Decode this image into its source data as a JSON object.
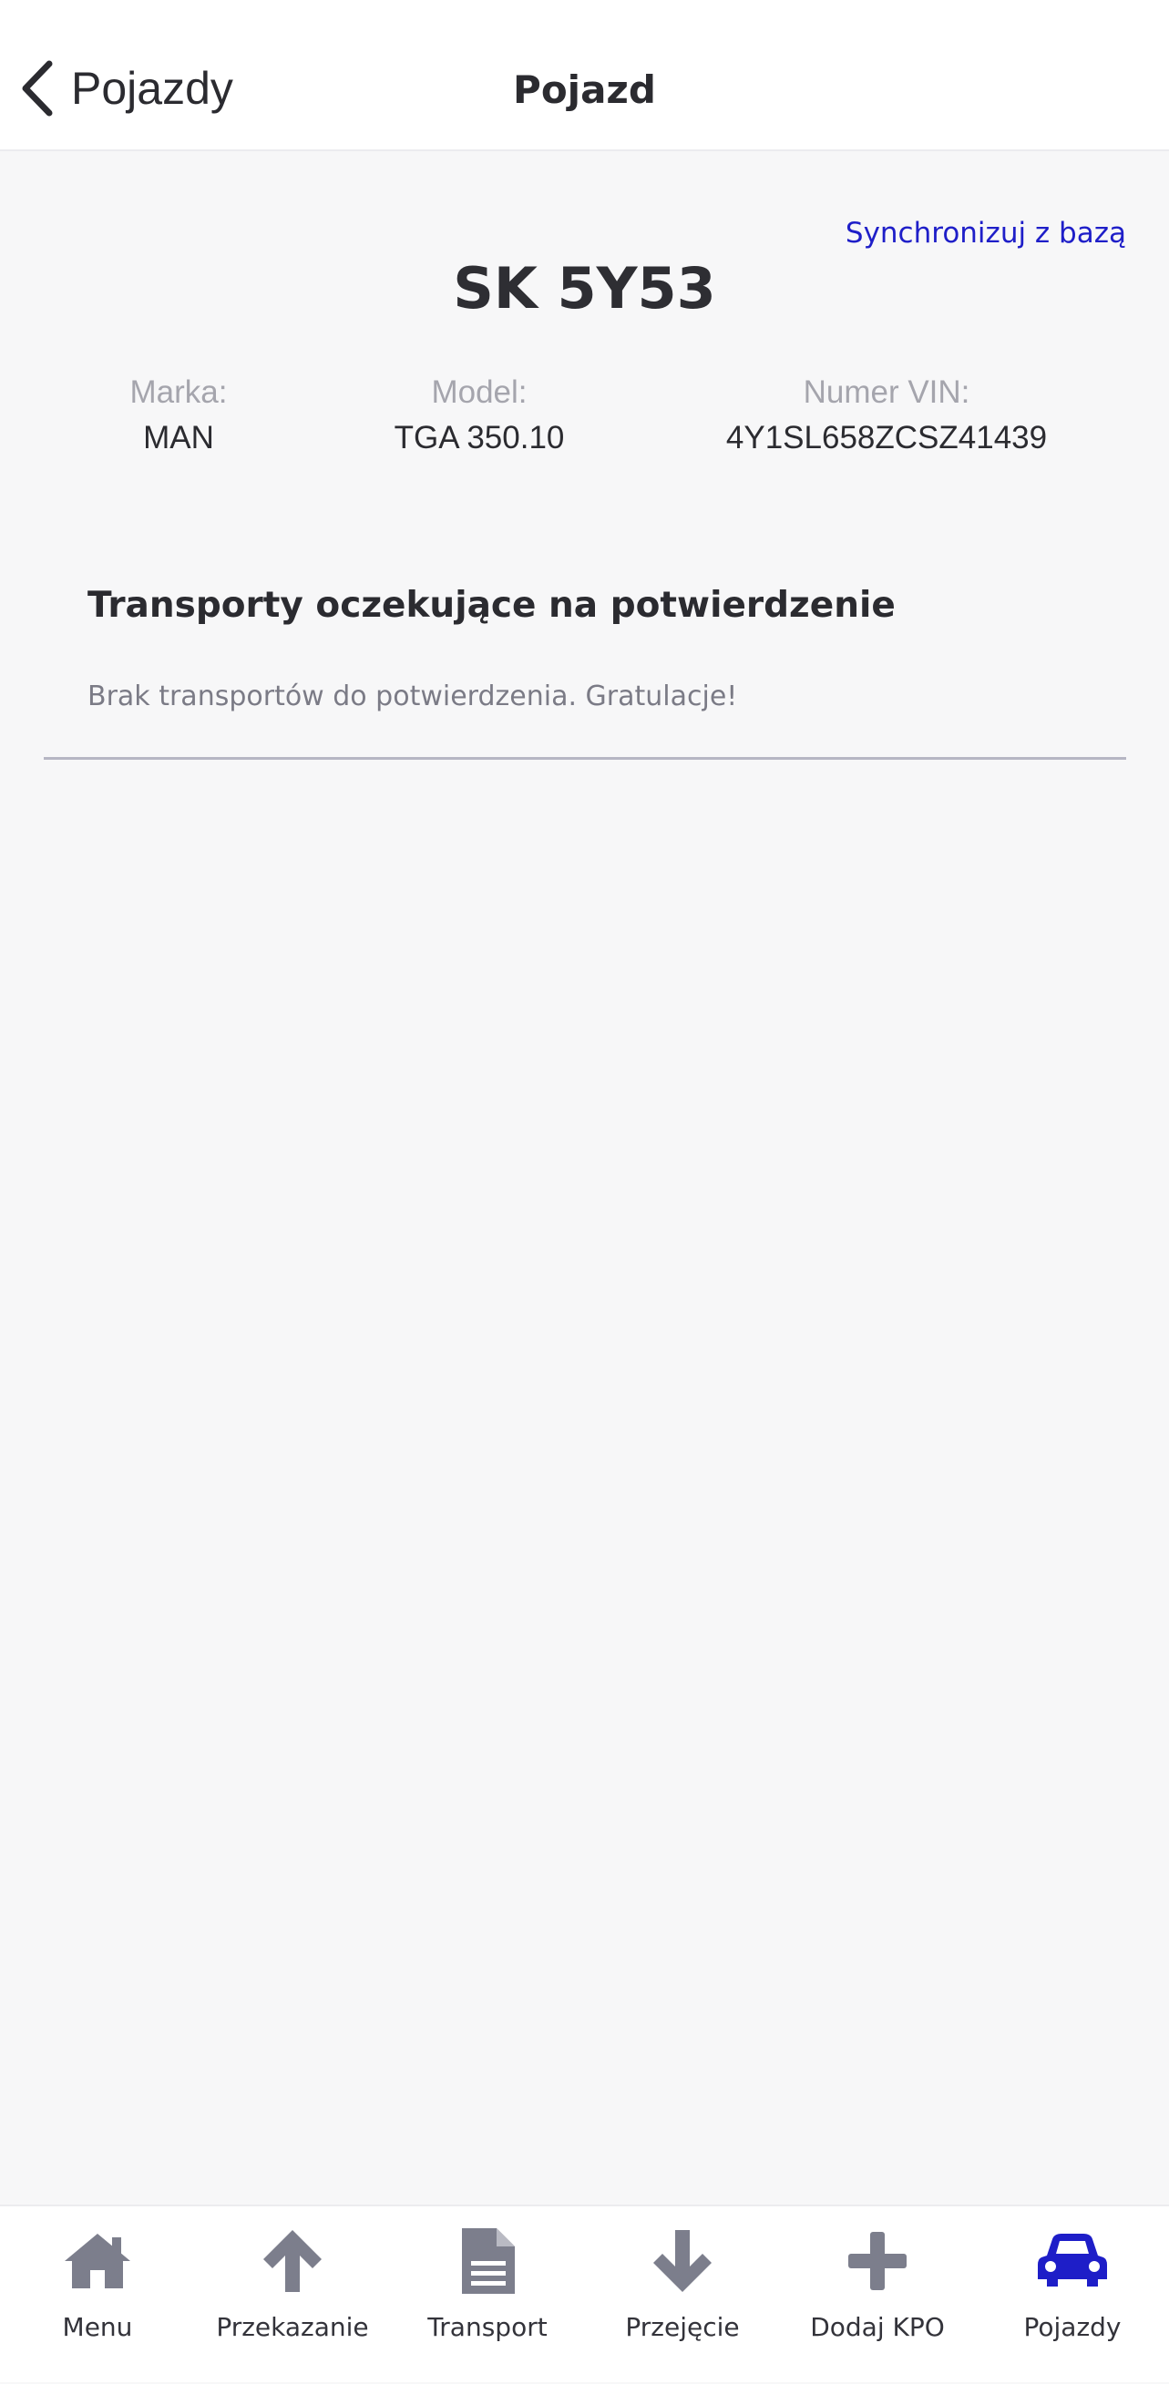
{
  "header": {
    "back_label": "Pojazdy",
    "title": "Pojazd"
  },
  "vehicle": {
    "sync_label": "Synchronizuj z bazą",
    "plate": "SK 5Y53",
    "brand_label": "Marka:",
    "brand_value": "MAN",
    "model_label": "Model:",
    "model_value": "TGA 350.10",
    "vin_label": "Numer VIN:",
    "vin_value": "4Y1SL658ZCSZ41439"
  },
  "pending": {
    "title": "Transporty oczekujące na potwierdzenie",
    "empty_text": "Brak transportów do potwierdzenia. Gratulacje!"
  },
  "tabbar": {
    "items": [
      {
        "label": "Menu",
        "icon": "home-icon"
      },
      {
        "label": "Przekazanie",
        "icon": "arrow-up-icon"
      },
      {
        "label": "Transport",
        "icon": "document-icon"
      },
      {
        "label": "Przejęcie",
        "icon": "arrow-down-icon"
      },
      {
        "label": "Dodaj KPO",
        "icon": "plus-icon"
      },
      {
        "label": "Pojazdy",
        "icon": "car-icon"
      }
    ],
    "active_index": 5
  },
  "colors": {
    "accent": "#1e1ec8",
    "icon_inactive": "#7c7e8c",
    "text": "#2b2b30",
    "muted": "#a5a5ad"
  }
}
